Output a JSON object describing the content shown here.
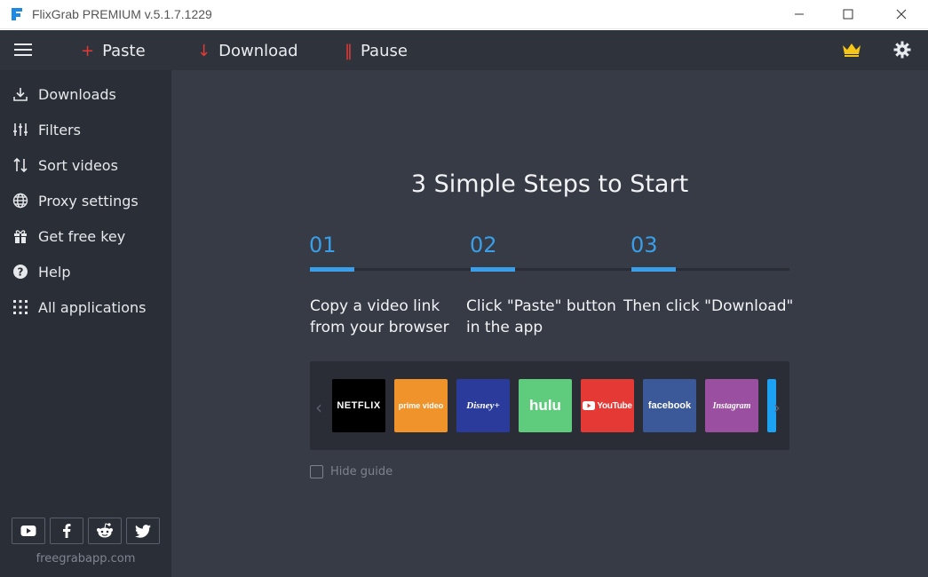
{
  "window": {
    "title": "FlixGrab PREMIUM  v.5.1.7.1229",
    "minimize_icon": "minimize-icon",
    "maximize_icon": "maximize-icon",
    "close_icon": "close-icon"
  },
  "toolbar": {
    "menu_icon": "hamburger-icon",
    "paste_label": "Paste",
    "download_label": "Download",
    "pause_label": "Pause",
    "accent_color": "#e53935",
    "crown_icon": "crown-icon",
    "settings_icon": "gear-icon"
  },
  "sidebar": {
    "items": [
      {
        "label": "Downloads",
        "icon": "download-icon"
      },
      {
        "label": "Filters",
        "icon": "filter-sliders-icon"
      },
      {
        "label": "Sort videos",
        "icon": "sort-icon"
      },
      {
        "label": "Proxy settings",
        "icon": "globe-icon"
      },
      {
        "label": "Get free key",
        "icon": "gift-icon"
      },
      {
        "label": "Help",
        "icon": "help-icon"
      },
      {
        "label": "All applications",
        "icon": "apps-grid-icon"
      }
    ],
    "social": [
      "youtube-icon",
      "facebook-icon",
      "reddit-icon",
      "twitter-icon"
    ],
    "site": "freegrabapp.com"
  },
  "guide": {
    "headline": "3 Simple Steps to Start",
    "accent_color": "#3a9ee8",
    "steps": [
      {
        "number": "01",
        "line1": "Copy a video link",
        "line2": "from your browser"
      },
      {
        "number": "02",
        "line1": "Click \"Paste\" button",
        "line2": "in the app"
      },
      {
        "number": "03",
        "line1": "Then click \"Download\"",
        "line2": ""
      }
    ],
    "services": [
      {
        "label": "NETFLIX",
        "color": "#000000"
      },
      {
        "label": "prime video",
        "color": "#f0932b"
      },
      {
        "label": "Disney+",
        "color": "#2a3b9c"
      },
      {
        "label": "hulu",
        "color": "#5fcb7d"
      },
      {
        "label": "YouTube",
        "color": "#e53935"
      },
      {
        "label": "facebook",
        "color": "#3b5998"
      },
      {
        "label": "Instagram",
        "color": "#9b4fa0"
      }
    ],
    "hide_label": "Hide guide"
  }
}
